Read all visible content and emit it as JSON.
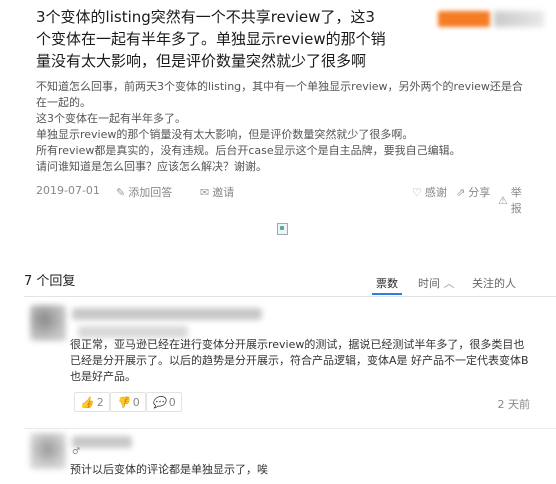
{
  "question": {
    "title": "3个变体的listing突然有一个不共享review了，这3个变体在一起有半年多了。单独显示review的那个销量没有太大影响，但是评价数量突然就少了很多啊",
    "body": [
      "不知道怎么回事，前两天3个变体的listing，其中有一个单独显示review，另外两个的review还是合在一起的。",
      "这3个变体在一起有半年多了。",
      "单独显示review的那个销量没有太大影响，但是评价数量突然就少了很多啊。",
      "所有review都是真实的，没有违规。后台开case显示这个是自主品牌，要我自己编辑。",
      "请问谁知道是怎么回事？应该怎么解决？谢谢。"
    ],
    "date": "2019-07-01",
    "add_answer": "添加回答",
    "invite": "邀请",
    "thanks": "感谢",
    "share": "分享",
    "report": "举报"
  },
  "answers": {
    "count_label": "7 个回复",
    "sort_tabs": [
      "票数",
      "时间",
      "关注的人"
    ],
    "active_sort": "票数",
    "items": [
      {
        "text": "很正常，亚马逊已经在进行变体分开展示review的测试，据说已经测试半年多了，很多类目也已经是分开展示了。以后的趋势是分开展示，符合产品逻辑，变体A是 好产品不一定代表变体B也是好产品。",
        "likes": "2",
        "dislikes": "0",
        "comments": "0",
        "time": "2 天前"
      },
      {
        "mark": "♂",
        "text": "预计以后变体的评论都是单独显示了，唉"
      }
    ]
  },
  "colors": {
    "accent": "#2e7de1",
    "brand_orange": "#f57c23"
  }
}
